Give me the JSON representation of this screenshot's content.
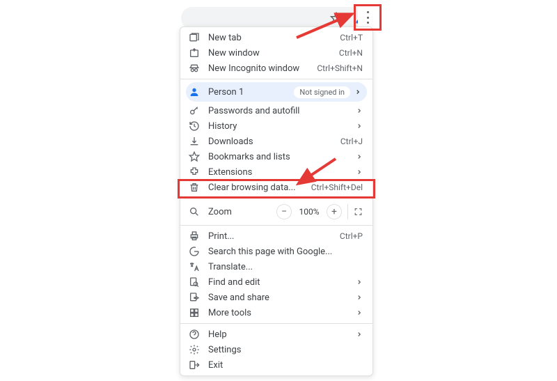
{
  "toolbar": {
    "star_icon": "star-icon",
    "profile_icon": "profile-icon",
    "kebab_icon": "kebab-menu-icon"
  },
  "profile_row": {
    "name": "Person 1",
    "badge": "Not signed in"
  },
  "zoom": {
    "label": "Zoom",
    "percent": "100%"
  },
  "menu": {
    "section1": [
      {
        "icon": "new-tab-icon",
        "label": "New tab",
        "accel": "Ctrl+T"
      },
      {
        "icon": "new-window-icon",
        "label": "New window",
        "accel": "Ctrl+N"
      },
      {
        "icon": "incognito-icon",
        "label": "New Incognito window",
        "accel": "Ctrl+Shift+N"
      }
    ],
    "section2": [
      {
        "icon": "key-icon",
        "label": "Passwords and autofill",
        "submenu": true
      },
      {
        "icon": "history-icon",
        "label": "History",
        "submenu": true
      },
      {
        "icon": "download-icon",
        "label": "Downloads",
        "accel": "Ctrl+J"
      },
      {
        "icon": "star-icon",
        "label": "Bookmarks and lists",
        "submenu": true
      },
      {
        "icon": "extensions-icon",
        "label": "Extensions",
        "submenu": true
      },
      {
        "icon": "trash-icon",
        "label": "Clear browsing data...",
        "accel": "Ctrl+Shift+Del"
      }
    ],
    "section3": [
      {
        "icon": "print-icon",
        "label": "Print...",
        "accel": "Ctrl+P"
      },
      {
        "icon": "google-icon",
        "label": "Search this page with Google..."
      },
      {
        "icon": "translate-icon",
        "label": "Translate..."
      },
      {
        "icon": "find-icon",
        "label": "Find and edit",
        "submenu": true
      },
      {
        "icon": "save-share-icon",
        "label": "Save and share",
        "submenu": true
      },
      {
        "icon": "more-tools-icon",
        "label": "More tools",
        "submenu": true
      }
    ],
    "section4": [
      {
        "icon": "help-icon",
        "label": "Help",
        "submenu": true
      },
      {
        "icon": "settings-icon",
        "label": "Settings"
      },
      {
        "icon": "exit-icon",
        "label": "Exit"
      }
    ]
  }
}
